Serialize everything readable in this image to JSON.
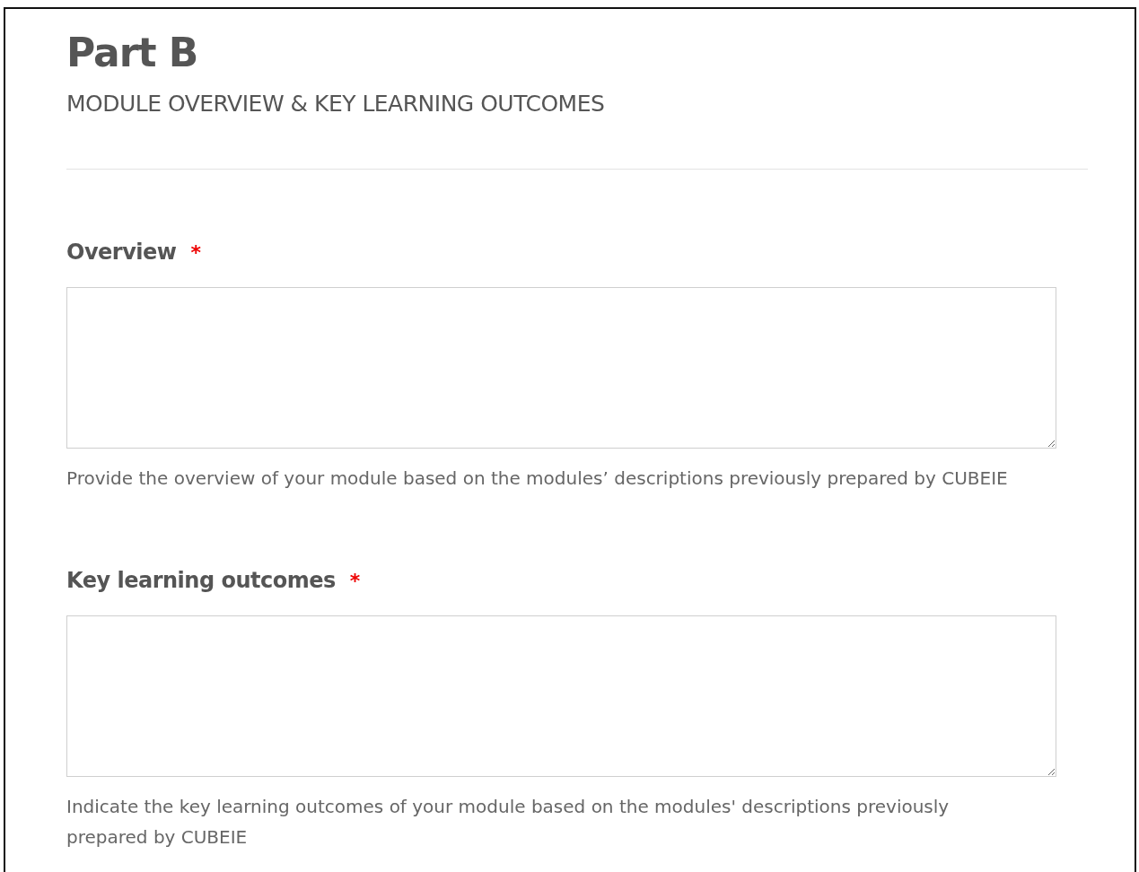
{
  "title": "Part B",
  "subtitle": "MODULE OVERVIEW & KEY LEARNING OUTCOMES",
  "fields": [
    {
      "label": "Overview",
      "required_mark": "*",
      "help_lines": [
        "Provide the overview of your module based on the modules’ descriptions previously prepared by CUBEIE"
      ]
    },
    {
      "label": "Key learning outcomes",
      "required_mark": "*",
      "help_lines": [
        "Indicate the key learning outcomes of your module based on the modules' descriptions previously",
        "prepared by CUBEIE"
      ]
    }
  ]
}
